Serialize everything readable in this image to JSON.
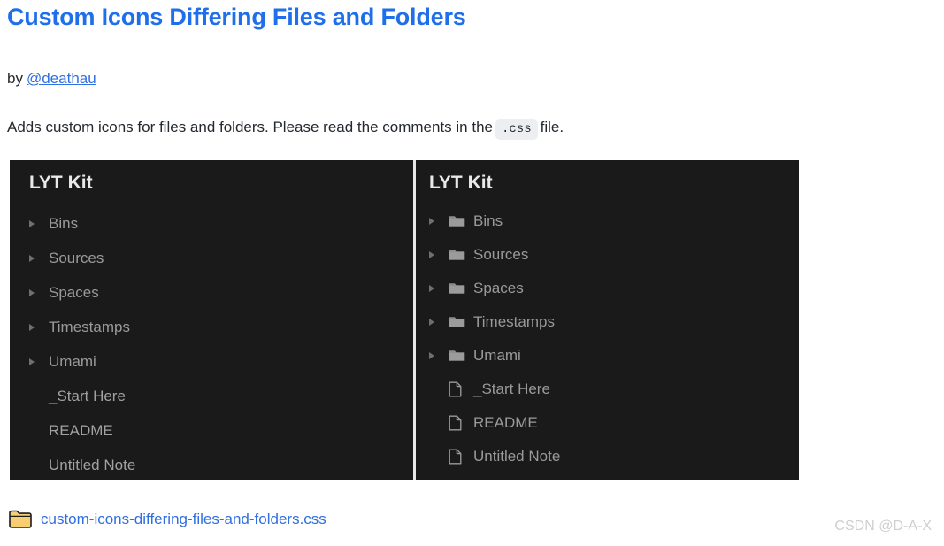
{
  "header": {
    "title": "Custom Icons Differing Files and Folders",
    "by_label": "by",
    "author": "@deathau",
    "description_before": "Adds custom icons for files and folders. Please read the comments in the",
    "code_chip": ".css",
    "description_after": "file."
  },
  "colors": {
    "link": "#2f6fe0",
    "title": "#1f6feb",
    "panel_bg": "#1a1a1a",
    "panel_text": "#9a9a9a",
    "panel_header_text": "#e9e9e9",
    "arrow": "#6f6f6f",
    "folder_badge_fill": "#f5c661",
    "watermark": "#cfcfcf"
  },
  "comparison": {
    "left_panel": {
      "header": "LYT Kit",
      "items": [
        {
          "label": "Bins",
          "type": "folder",
          "arrow": true,
          "icon": "none"
        },
        {
          "label": "Sources",
          "type": "folder",
          "arrow": true,
          "icon": "none"
        },
        {
          "label": "Spaces",
          "type": "folder",
          "arrow": true,
          "icon": "none"
        },
        {
          "label": "Timestamps",
          "type": "folder",
          "arrow": true,
          "icon": "none"
        },
        {
          "label": "Umami",
          "type": "folder",
          "arrow": true,
          "icon": "none"
        },
        {
          "label": "_Start Here",
          "type": "file",
          "arrow": false,
          "icon": "none"
        },
        {
          "label": "README",
          "type": "file",
          "arrow": false,
          "icon": "none"
        },
        {
          "label": "Untitled Note",
          "type": "file",
          "arrow": false,
          "icon": "none"
        }
      ]
    },
    "right_panel": {
      "header": "LYT Kit",
      "items": [
        {
          "label": "Bins",
          "type": "folder",
          "arrow": true,
          "icon": "folder-icon"
        },
        {
          "label": "Sources",
          "type": "folder",
          "arrow": true,
          "icon": "folder-icon"
        },
        {
          "label": "Spaces",
          "type": "folder",
          "arrow": true,
          "icon": "folder-icon"
        },
        {
          "label": "Timestamps",
          "type": "folder",
          "arrow": true,
          "icon": "folder-icon"
        },
        {
          "label": "Umami",
          "type": "folder",
          "arrow": true,
          "icon": "folder-icon"
        },
        {
          "label": "_Start Here",
          "type": "file",
          "arrow": false,
          "icon": "file-icon"
        },
        {
          "label": "README",
          "type": "file",
          "arrow": false,
          "icon": "file-icon"
        },
        {
          "label": "Untitled Note",
          "type": "file",
          "arrow": false,
          "icon": "file-icon"
        }
      ]
    }
  },
  "footer": {
    "file_icon": "folder-icon",
    "file_name": "custom-icons-differing-files-and-folders.css",
    "watermark": "CSDN @D-A-X"
  }
}
